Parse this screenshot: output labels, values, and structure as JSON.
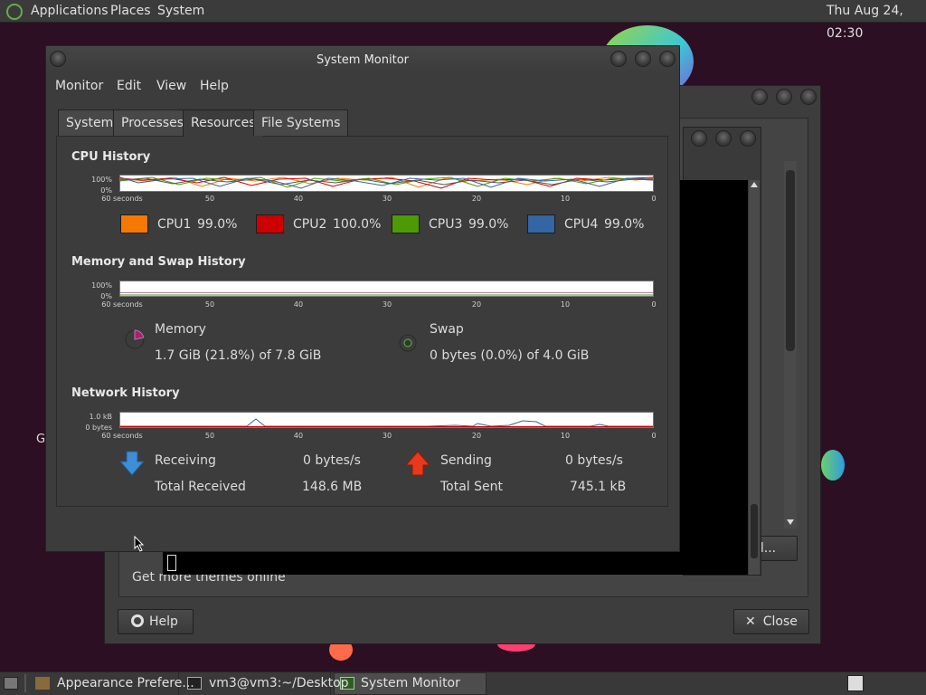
{
  "top_panel": {
    "menus": [
      "Applications",
      "Places",
      "System"
    ],
    "clock": "Thu Aug 24, 02:30"
  },
  "desktop": {
    "stray_letter": "G"
  },
  "back_window": {
    "get_more": "Get more themes online",
    "help": "Help",
    "close": "Close",
    "install_partial": "ll..."
  },
  "sysmon": {
    "title": "System Monitor",
    "menus": [
      "Monitor",
      "Edit",
      "View",
      "Help"
    ],
    "tabs": [
      "System",
      "Processes",
      "Resources",
      "File Systems"
    ],
    "active_tab": "Resources",
    "cpu": {
      "title": "CPU History",
      "y_labels": [
        "100%",
        "0%"
      ],
      "x_labels": [
        "60 seconds",
        "50",
        "40",
        "30",
        "20",
        "10",
        "0"
      ],
      "items": [
        {
          "name": "CPU1",
          "value": "99.0%",
          "color": "#f57900"
        },
        {
          "name": "CPU2",
          "value": "100.0%",
          "color": "#cc0000"
        },
        {
          "name": "CPU3",
          "value": "99.0%",
          "color": "#4e9a06"
        },
        {
          "name": "CPU4",
          "value": "99.0%",
          "color": "#3465a4"
        }
      ]
    },
    "memory": {
      "title": "Memory and Swap History",
      "y_labels": [
        "100%",
        "0%"
      ],
      "x_labels": [
        "60 seconds",
        "50",
        "40",
        "30",
        "20",
        "10",
        "0"
      ],
      "memory_label": "Memory",
      "memory_value": "1.7 GiB (21.8%) of 7.8 GiB",
      "swap_label": "Swap",
      "swap_value": "0 bytes (0.0%) of 4.0 GiB",
      "memory_color": "#ad7fa8",
      "swap_color": "#4e9a06",
      "memory_fraction": 0.218,
      "swap_fraction": 0.0
    },
    "network": {
      "title": "Network History",
      "y_labels": [
        "1.0 kB",
        "0 bytes"
      ],
      "x_labels": [
        "60 seconds",
        "50",
        "40",
        "30",
        "20",
        "10",
        "0"
      ],
      "receiving_label": "Receiving",
      "receiving_value": "0 bytes/s",
      "total_received_label": "Total Received",
      "total_received_value": "148.6 MB",
      "sending_label": "Sending",
      "sending_value": "0 bytes/s",
      "total_sent_label": "Total Sent",
      "total_sent_value": "745.1 kB"
    }
  },
  "taskbar": {
    "items": [
      "Appearance Prefere...",
      "vm3@vm3:~/Desktop",
      "System Monitor"
    ]
  }
}
